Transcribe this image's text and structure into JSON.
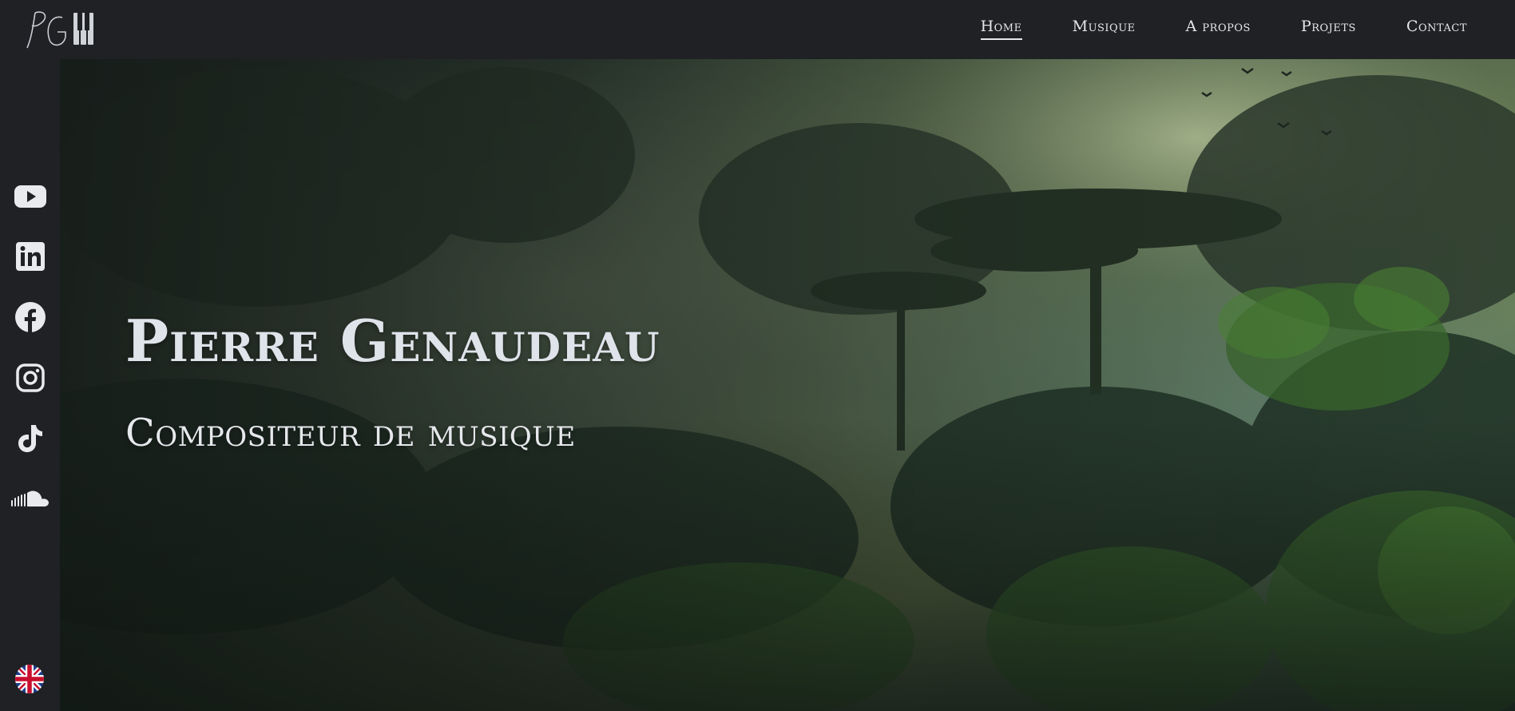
{
  "brand": {
    "logo_text": "PG"
  },
  "nav": {
    "items": [
      {
        "label": "Home",
        "active": true
      },
      {
        "label": "Musique",
        "active": false
      },
      {
        "label": "A propos",
        "active": false
      },
      {
        "label": "Projets",
        "active": false
      },
      {
        "label": "Contact",
        "active": false
      }
    ]
  },
  "social": {
    "icons": [
      "youtube-icon",
      "linkedin-icon",
      "facebook-icon",
      "instagram-icon",
      "tiktok-icon",
      "soundcloud-icon"
    ],
    "language_flag": "uk-flag-icon"
  },
  "hero": {
    "title": "Pierre Genaudeau",
    "subtitle": "Compositeur de musique"
  },
  "colors": {
    "background": "#1f2124",
    "text": "#e4e6ea",
    "icon": "#e8eaee"
  }
}
